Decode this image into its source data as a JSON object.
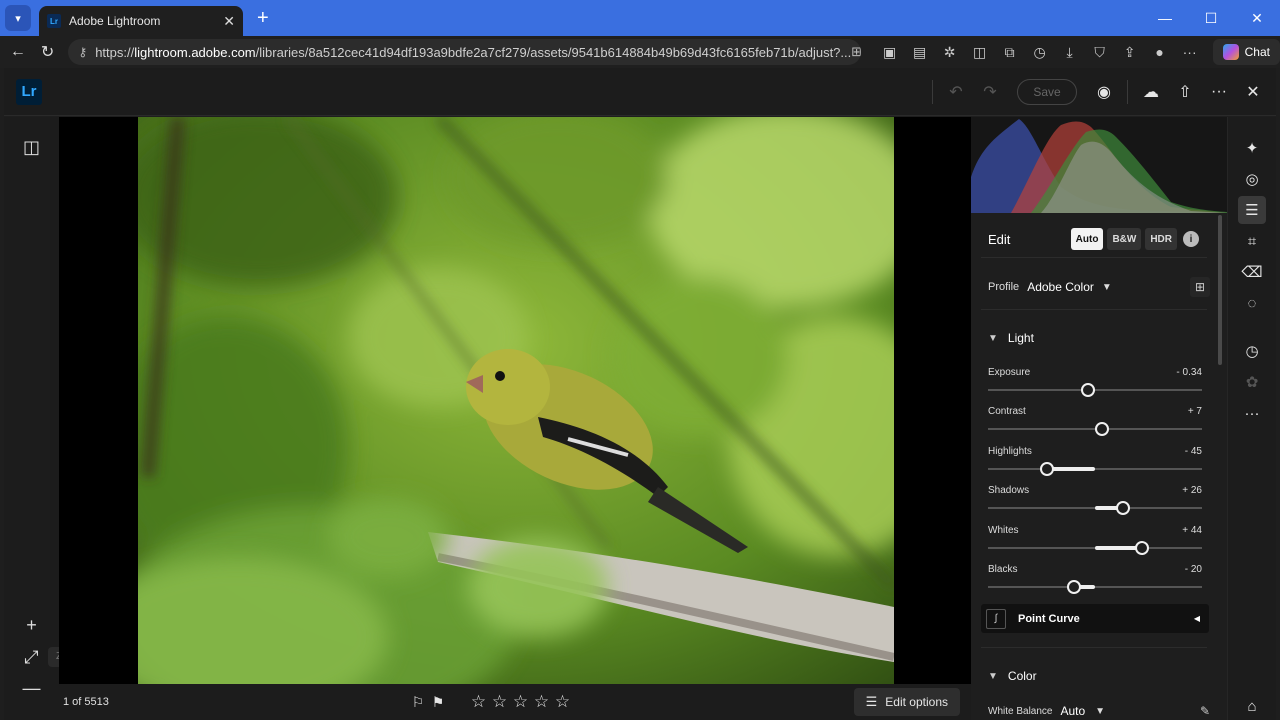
{
  "browser": {
    "tab_title": "Adobe Lightroom",
    "tab_favicon": "Lr",
    "url_prefix": "https://",
    "url_host": "lightroom.adobe.com",
    "url_path": "/libraries/8a512cec41d94df193a9bdfe2a7cf279/assets/9541b614884b49b69d43fc6165feb71b/adjust?...",
    "chat_label": "Chat"
  },
  "app": {
    "logo": "Lr",
    "save_label": "Save",
    "accent_color": "#31a8ff"
  },
  "left_rail": {
    "zoom_tooltip": "Zoom to fit"
  },
  "bottom": {
    "count": "1 of 5513",
    "edit_options_label": "Edit options"
  },
  "panel": {
    "edit_title": "Edit",
    "modes": [
      "Auto",
      "B&W",
      "HDR"
    ],
    "profile_label": "Profile",
    "profile_value": "Adobe Color",
    "light_title": "Light",
    "sliders": [
      {
        "label": "Exposure",
        "value": "- 0.34",
        "num": -0.34,
        "min": -5,
        "max": 5
      },
      {
        "label": "Contrast",
        "value": "+ 7",
        "num": 7,
        "min": -100,
        "max": 100
      },
      {
        "label": "Highlights",
        "value": "- 45",
        "num": -45,
        "min": -100,
        "max": 100
      },
      {
        "label": "Shadows",
        "value": "+ 26",
        "num": 26,
        "min": -100,
        "max": 100
      },
      {
        "label": "Whites",
        "value": "+ 44",
        "num": 44,
        "min": -100,
        "max": 100
      },
      {
        "label": "Blacks",
        "value": "- 20",
        "num": -20,
        "min": -100,
        "max": 100
      }
    ],
    "point_curve_label": "Point Curve",
    "color_title": "Color",
    "wb_label": "White Balance",
    "wb_value": "Auto"
  },
  "icons": {
    "compare": "compare-icon",
    "zoom_in": "plus-icon",
    "zoom_fit": "expand-icon",
    "zoom_out": "minus-icon",
    "flag": "flag-icon",
    "reject": "reject-flag-icon",
    "star": "star-icon"
  }
}
